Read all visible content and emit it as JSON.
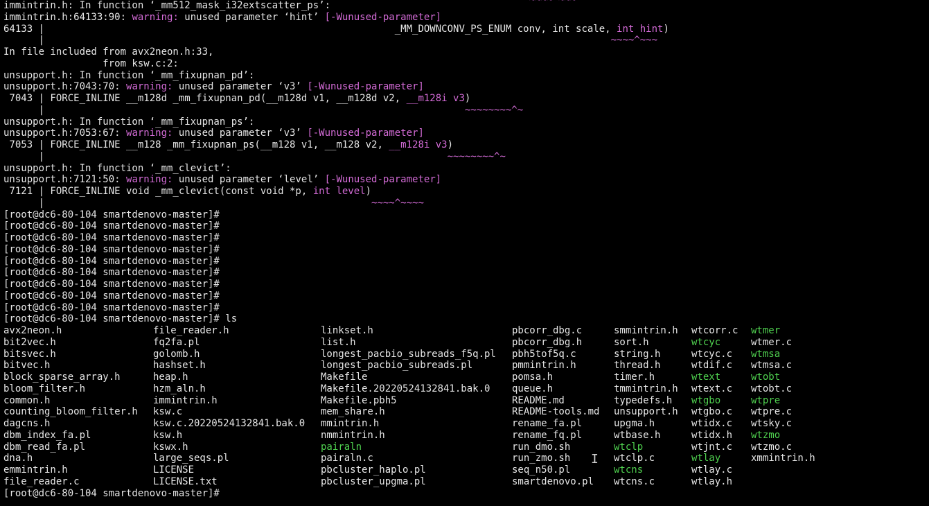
{
  "terminal": {
    "top_tilde": "~~~~ ~~~",
    "lines": [
      {
        "segs": [
          {
            "t": "immintrin.h: In function ‘_mm512_mask_i32extscatter_ps’:",
            "c": "plain"
          }
        ]
      },
      {
        "segs": [
          {
            "t": "immintrin.h:64133:90: ",
            "c": "plain"
          },
          {
            "t": "warning:",
            "c": "warn"
          },
          {
            "t": " unused parameter ‘hint’ ",
            "c": "plain"
          },
          {
            "t": "[-Wunused-parameter]",
            "c": "flag"
          }
        ]
      },
      {
        "segs": [
          {
            "t": "64133 |                                                            _MM_DOWNCONV_PS_ENUM conv, int scale, ",
            "c": "plain"
          },
          {
            "t": "int hint",
            "c": "hl"
          },
          {
            "t": ")",
            "c": "plain"
          }
        ]
      },
      {
        "segs": [
          {
            "t": "      |                                                                                                 ",
            "c": "plain"
          },
          {
            "t": "~~~~^~~~",
            "c": "caret"
          }
        ]
      },
      {
        "segs": [
          {
            "t": "In file included from avx2neon.h:33,",
            "c": "plain"
          }
        ]
      },
      {
        "segs": [
          {
            "t": "                 from ksw.c:2:",
            "c": "plain"
          }
        ]
      },
      {
        "segs": [
          {
            "t": "unsupport.h: In function ‘_mm_fixupnan_pd’:",
            "c": "plain"
          }
        ]
      },
      {
        "segs": [
          {
            "t": "unsupport.h:7043:70: ",
            "c": "plain"
          },
          {
            "t": "warning:",
            "c": "warn"
          },
          {
            "t": " unused parameter ‘v3’ ",
            "c": "plain"
          },
          {
            "t": "[-Wunused-parameter]",
            "c": "flag"
          }
        ]
      },
      {
        "segs": [
          {
            "t": " 7043 | FORCE_INLINE __m128d _mm_fixupnan_pd(__m128d v1, __m128d v2, ",
            "c": "plain"
          },
          {
            "t": "__m128i v3",
            "c": "hl"
          },
          {
            "t": ")",
            "c": "plain"
          }
        ]
      },
      {
        "segs": [
          {
            "t": "      |                                                                        ",
            "c": "plain"
          },
          {
            "t": "~~~~~~~~^~",
            "c": "caret"
          }
        ]
      },
      {
        "segs": [
          {
            "t": "unsupport.h: In function ‘_mm_fixupnan_ps’:",
            "c": "plain"
          }
        ]
      },
      {
        "segs": [
          {
            "t": "unsupport.h:7053:67: ",
            "c": "plain"
          },
          {
            "t": "warning:",
            "c": "warn"
          },
          {
            "t": " unused parameter ‘v3’ ",
            "c": "plain"
          },
          {
            "t": "[-Wunused-parameter]",
            "c": "flag"
          }
        ]
      },
      {
        "segs": [
          {
            "t": " 7053 | FORCE_INLINE __m128 _mm_fixupnan_ps(__m128 v1, __m128 v2, ",
            "c": "plain"
          },
          {
            "t": "__m128i v3",
            "c": "hl"
          },
          {
            "t": ")",
            "c": "plain"
          }
        ]
      },
      {
        "segs": [
          {
            "t": "      |                                                                     ",
            "c": "plain"
          },
          {
            "t": "~~~~~~~~^~",
            "c": "caret"
          }
        ]
      },
      {
        "segs": [
          {
            "t": "unsupport.h: In function ‘_mm_clevict’:",
            "c": "plain"
          }
        ]
      },
      {
        "segs": [
          {
            "t": "unsupport.h:7121:50: ",
            "c": "plain"
          },
          {
            "t": "warning:",
            "c": "warn"
          },
          {
            "t": " unused parameter ‘level’ ",
            "c": "plain"
          },
          {
            "t": "[-Wunused-parameter]",
            "c": "flag"
          }
        ]
      },
      {
        "segs": [
          {
            "t": " 7121 | FORCE_INLINE void _mm_clevict(const void *p, ",
            "c": "plain"
          },
          {
            "t": "int level",
            "c": "hl"
          },
          {
            "t": ")",
            "c": "plain"
          }
        ]
      },
      {
        "segs": [
          {
            "t": "      |                                                        ",
            "c": "plain"
          },
          {
            "t": "~~~~^~~~~",
            "c": "caret"
          }
        ]
      },
      {
        "segs": [
          {
            "t": "[root@dc6-80-104 smartdenovo-master]#",
            "c": "plain"
          }
        ]
      },
      {
        "segs": [
          {
            "t": "[root@dc6-80-104 smartdenovo-master]#",
            "c": "plain"
          }
        ]
      },
      {
        "segs": [
          {
            "t": "[root@dc6-80-104 smartdenovo-master]#",
            "c": "plain"
          }
        ]
      },
      {
        "segs": [
          {
            "t": "[root@dc6-80-104 smartdenovo-master]#",
            "c": "plain"
          }
        ]
      },
      {
        "segs": [
          {
            "t": "[root@dc6-80-104 smartdenovo-master]#",
            "c": "plain"
          }
        ]
      },
      {
        "segs": [
          {
            "t": "[root@dc6-80-104 smartdenovo-master]#",
            "c": "plain"
          }
        ]
      },
      {
        "segs": [
          {
            "t": "[root@dc6-80-104 smartdenovo-master]#",
            "c": "plain"
          }
        ]
      },
      {
        "segs": [
          {
            "t": "[root@dc6-80-104 smartdenovo-master]#",
            "c": "plain"
          }
        ]
      },
      {
        "segs": [
          {
            "t": "[root@dc6-80-104 smartdenovo-master]#",
            "c": "plain"
          }
        ]
      },
      {
        "segs": [
          {
            "t": "[root@dc6-80-104 smartdenovo-master]# ls",
            "c": "plain"
          }
        ]
      }
    ],
    "ls_rows": [
      [
        {
          "t": "avx2neon.h"
        },
        {
          "t": "file_reader.h"
        },
        {
          "t": "linkset.h"
        },
        {
          "t": "pbcorr_dbg.c"
        },
        {
          "t": "smmintrin.h"
        },
        {
          "t": "wtcorr.c"
        },
        {
          "t": "wtmer",
          "exec": true
        }
      ],
      [
        {
          "t": "bit2vec.h"
        },
        {
          "t": "fq2fa.pl"
        },
        {
          "t": "list.h"
        },
        {
          "t": "pbcorr_dbg.h"
        },
        {
          "t": "sort.h"
        },
        {
          "t": "wtcyc",
          "exec": true
        },
        {
          "t": "wtmer.c"
        }
      ],
      [
        {
          "t": "bitsvec.h"
        },
        {
          "t": "golomb.h"
        },
        {
          "t": "longest_pacbio_subreads_f5q.pl"
        },
        {
          "t": "pbh5tof5q.c"
        },
        {
          "t": "string.h"
        },
        {
          "t": "wtcyc.c"
        },
        {
          "t": "wtmsa",
          "exec": true
        }
      ],
      [
        {
          "t": "bitvec.h"
        },
        {
          "t": "hashset.h"
        },
        {
          "t": "longest_pacbio_subreads.pl"
        },
        {
          "t": "pmmintrin.h"
        },
        {
          "t": "thread.h"
        },
        {
          "t": "wtdif.c"
        },
        {
          "t": "wtmsa.c"
        }
      ],
      [
        {
          "t": "block_sparse_array.h"
        },
        {
          "t": "heap.h"
        },
        {
          "t": "Makefile"
        },
        {
          "t": "pomsa.h"
        },
        {
          "t": "timer.h"
        },
        {
          "t": "wtext",
          "exec": true
        },
        {
          "t": "wtobt",
          "exec": true
        }
      ],
      [
        {
          "t": "bloom_filter.h"
        },
        {
          "t": "hzm_aln.h"
        },
        {
          "t": "Makefile.20220524132841.bak.0"
        },
        {
          "t": "queue.h"
        },
        {
          "t": "tmmintrin.h"
        },
        {
          "t": "wtext.c"
        },
        {
          "t": "wtobt.c"
        }
      ],
      [
        {
          "t": "common.h"
        },
        {
          "t": "immintrin.h"
        },
        {
          "t": "Makefile.pbh5"
        },
        {
          "t": "README.md"
        },
        {
          "t": "typedefs.h"
        },
        {
          "t": "wtgbo",
          "exec": true
        },
        {
          "t": "wtpre",
          "exec": true
        }
      ],
      [
        {
          "t": "counting_bloom_filter.h"
        },
        {
          "t": "ksw.c"
        },
        {
          "t": "mem_share.h"
        },
        {
          "t": "README-tools.md"
        },
        {
          "t": "unsupport.h"
        },
        {
          "t": "wtgbo.c"
        },
        {
          "t": "wtpre.c"
        }
      ],
      [
        {
          "t": "dagcns.h"
        },
        {
          "t": "ksw.c.20220524132841.bak.0"
        },
        {
          "t": "mmintrin.h"
        },
        {
          "t": "rename_fa.pl"
        },
        {
          "t": "upgma.h"
        },
        {
          "t": "wtidx.c"
        },
        {
          "t": "wtsky.c"
        }
      ],
      [
        {
          "t": "dbm_index_fa.pl"
        },
        {
          "t": "ksw.h"
        },
        {
          "t": "nmmintrin.h"
        },
        {
          "t": "rename_fq.pl"
        },
        {
          "t": "wtbase.h"
        },
        {
          "t": "wtidx.h"
        },
        {
          "t": "wtzmo",
          "exec": true
        }
      ],
      [
        {
          "t": "dbm_read_fa.pl"
        },
        {
          "t": "kswx.h"
        },
        {
          "t": "pairaln",
          "exec": true
        },
        {
          "t": "run_dmo.sh"
        },
        {
          "t": "wtclp",
          "exec": true
        },
        {
          "t": "wtjnt.c"
        },
        {
          "t": "wtzmo.c"
        }
      ],
      [
        {
          "t": "dna.h"
        },
        {
          "t": "large_seqs.pl"
        },
        {
          "t": "pairaln.c"
        },
        {
          "t": "run_zmo.sh"
        },
        {
          "t": "wtclp.c"
        },
        {
          "t": "wtlay",
          "exec": true
        },
        {
          "t": "xmmintrin.h"
        }
      ],
      [
        {
          "t": "emmintrin.h"
        },
        {
          "t": "LICENSE"
        },
        {
          "t": "pbcluster_haplo.pl"
        },
        {
          "t": "seq_n50.pl"
        },
        {
          "t": "wtcns",
          "exec": true
        },
        {
          "t": "wtlay.c"
        },
        {
          "t": ""
        }
      ],
      [
        {
          "t": "file_reader.c"
        },
        {
          "t": "LICENSE.txt"
        },
        {
          "t": "pbcluster_upgma.pl"
        },
        {
          "t": "smartdenovo.pl"
        },
        {
          "t": "wtcns.c"
        },
        {
          "t": "wtlay.h"
        },
        {
          "t": ""
        }
      ]
    ],
    "final_prompt": "[root@dc6-80-104 smartdenovo-master]#",
    "colors": {
      "background": "#000000",
      "text": "#e6e6e6",
      "warning": "#d36bd6",
      "executable": "#4fd14f"
    }
  }
}
